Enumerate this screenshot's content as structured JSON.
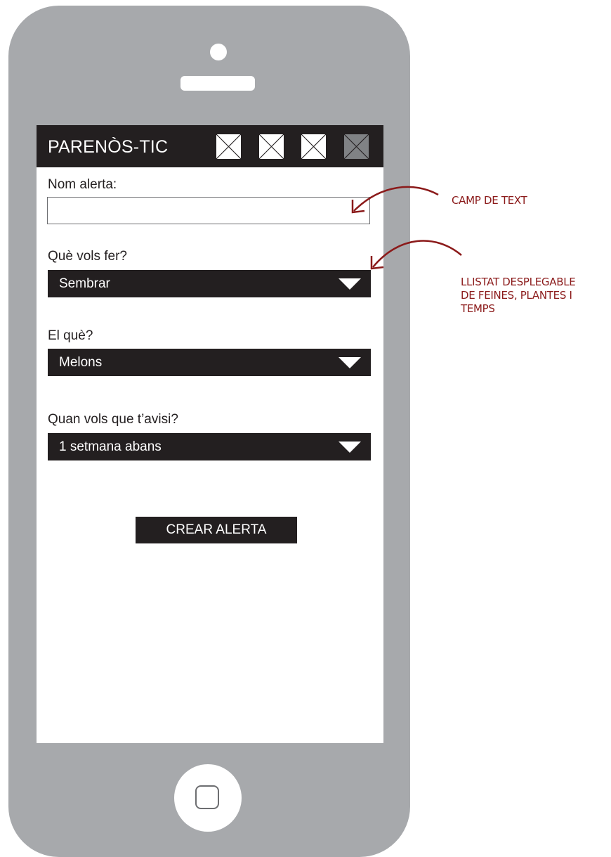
{
  "app": {
    "title": "PARENÒS-TIC",
    "header_icons": [
      "image-placeholder-icon",
      "image-placeholder-icon",
      "image-placeholder-icon",
      "image-placeholder-icon"
    ]
  },
  "form": {
    "name_label": "Nom alerta:",
    "name_value": "",
    "action_label": "Què vols fer?",
    "action_value": "Sembrar",
    "what_label": "El què?",
    "what_value": "Melons",
    "when_label": "Quan vols que t’avisi?",
    "when_value": "1 setmana abans",
    "submit_label": "CREAR ALERTA"
  },
  "annotations": {
    "text_field": "CAMP DE TEXT",
    "dropdown_line1": "LLISTAT DESPLEGABLE",
    "dropdown_line2": "DE FEINES, PLANTES I",
    "dropdown_line3": "TEMPS"
  },
  "colors": {
    "phone_body": "#a7a9ac",
    "ui_dark": "#231f20",
    "annotation": "#8b1a1a"
  }
}
